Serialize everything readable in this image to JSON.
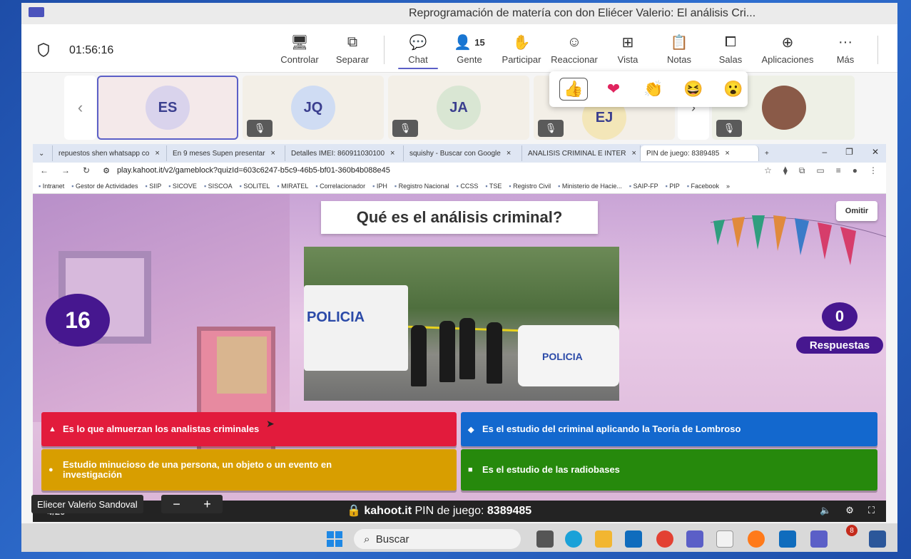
{
  "window": {
    "title": "Reprogramación de matería con don Eliécer Valerio: El análisis Cri..."
  },
  "toolbar": {
    "timer": "01:56:16",
    "buttons": [
      {
        "label": "Controlar",
        "icon": "control-icon"
      },
      {
        "label": "Separar",
        "icon": "popout-icon"
      },
      {
        "label": "Chat",
        "icon": "chat-icon"
      },
      {
        "label": "Gente",
        "icon": "people-icon",
        "count": "15"
      },
      {
        "label": "Participar",
        "icon": "raise-hand-icon"
      },
      {
        "label": "Reaccionar",
        "icon": "smiley-icon"
      },
      {
        "label": "Vista",
        "icon": "grid-icon"
      },
      {
        "label": "Notas",
        "icon": "notes-icon"
      },
      {
        "label": "Salas",
        "icon": "rooms-icon"
      },
      {
        "label": "Aplicaciones",
        "icon": "add-apps-icon"
      },
      {
        "label": "Más",
        "icon": "more-icon"
      }
    ]
  },
  "participants": [
    {
      "initials": "ES"
    },
    {
      "initials": "JQ"
    },
    {
      "initials": "JA"
    },
    {
      "initials": "EJ"
    }
  ],
  "reactions": [
    "👍",
    "❤",
    "👏",
    "😆",
    "😮"
  ],
  "browser": {
    "tabs": [
      "repuestos shen whatsapp co",
      "En 9 meses Supen presentar",
      "Detalles IMEI: 860911030100",
      "squishy - Buscar con Google",
      "ANALISIS CRIMINAL E INTER",
      "PIN de juego: 8389485"
    ],
    "url": "play.kahoot.it/v2/gameblock?quizId=603c6247-b5c9-46b5-bf01-360b4b088e45",
    "bookmarks": [
      "Intranet",
      "Gestor de Actividades",
      "SIIP",
      "SICOVE",
      "SISCOA",
      "SOLITEL",
      "MIRATEL",
      "Correlacionador",
      "IPH",
      "Registro Nacional",
      "CCSS",
      "TSE",
      "Registro Civil",
      "Ministerio de Hacie...",
      "SAIP-FP",
      "PIP",
      "Facebook"
    ]
  },
  "kahoot": {
    "question": "Qué es el análisis criminal?",
    "skip_label": "Omitir",
    "timer": "16",
    "answers_count": "0",
    "answers_label": "Respuestas",
    "photo_text_van": "POLICIA",
    "photo_text_truck": "POLICIA",
    "answers": [
      {
        "symbol": "▲",
        "text": "Es lo que almuerzan los analistas criminales",
        "color": "#e21b3c"
      },
      {
        "symbol": "◆",
        "text": "Es el estudio del criminal aplicando la Teoría de Lombroso",
        "color": "#1368ce"
      },
      {
        "symbol": "●",
        "text": "Estudio minucioso de una persona, un objeto o un evento en investigación",
        "color": "#d89e00"
      },
      {
        "symbol": "■",
        "text": "Es el estudio de las radiobases",
        "color": "#26890c"
      }
    ],
    "page": "4/20",
    "pin_brand": "kahoot.it",
    "pin_label": "PIN de juego:",
    "pin_value": "8389485"
  },
  "presenter": {
    "name": "Eliecer Valerio Sandoval"
  },
  "taskbar": {
    "search_placeholder": "Buscar",
    "badge_count": "8"
  }
}
